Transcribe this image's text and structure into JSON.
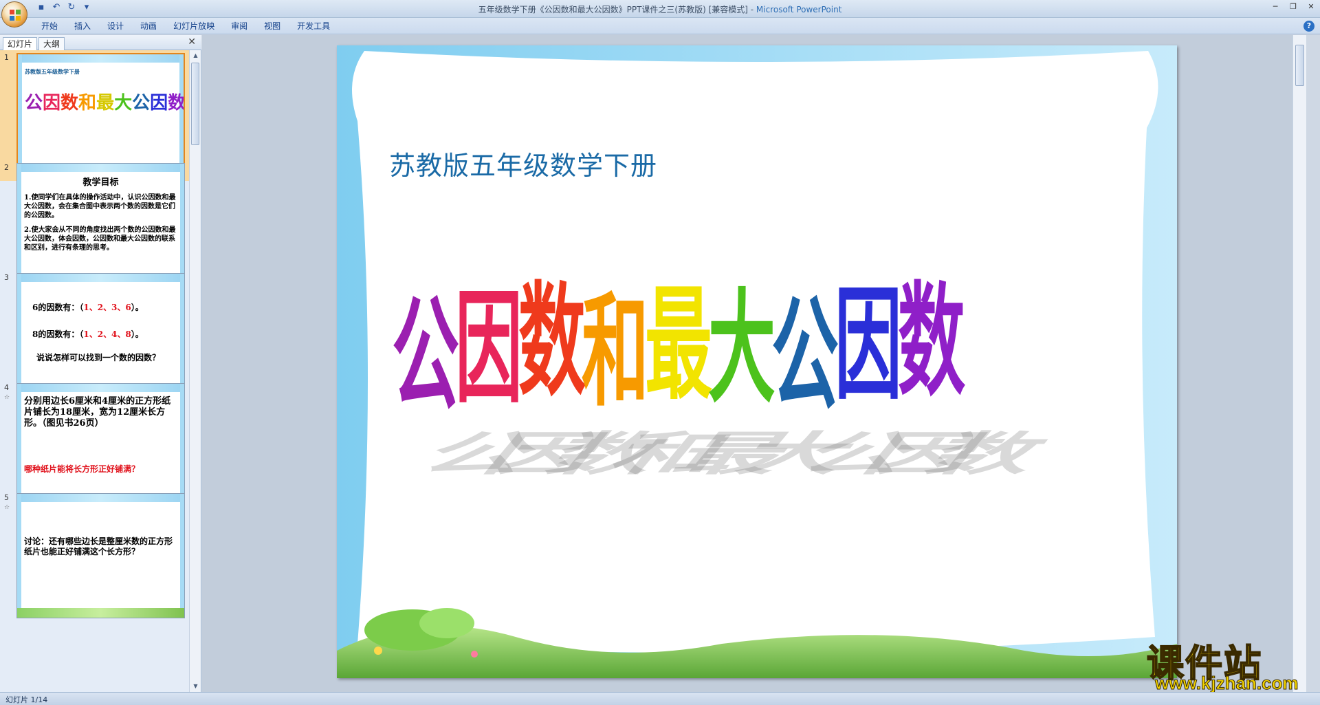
{
  "window": {
    "title": "五年级数学下册《公因数和最大公因数》PPT课件之三(苏教版) [兼容模式] - ",
    "app_name": "Microsoft PowerPoint"
  },
  "ribbon": {
    "tabs": [
      "开始",
      "插入",
      "设计",
      "动画",
      "幻灯片放映",
      "审阅",
      "视图",
      "开发工具"
    ]
  },
  "pane": {
    "tab_slides": "幻灯片",
    "tab_outline": "大纲"
  },
  "thumbnails": [
    {
      "num": "1",
      "subtitle": "苏教版五年级数学下册",
      "title_chars": [
        "公",
        "因",
        "数",
        "和",
        "最",
        "大",
        "公",
        "因",
        "数"
      ]
    },
    {
      "num": "2",
      "heading": "教学目标",
      "p1": "1.使同学们在具体的操作活动中，认识公因数和最大公因数，会在集合图中表示两个数的因数是它们的公因数。",
      "p2": "2.使大家会从不同的角度找出两个数的公因数和最大公因数，体会因数，公因数和最大公因数的联系和区别，进行有条理的思考。"
    },
    {
      "num": "3",
      "l1a": "6的因数有：（",
      "l1b": "1、2、3、6",
      "l1c": "）。",
      "l2a": "8的因数有：（",
      "l2b": "1、2、4、8",
      "l2c": "）。",
      "l3": "说说怎样可以找到一个数的因数？"
    },
    {
      "num": "4",
      "anim_mark": "☆",
      "text": "分别用边长6厘米和4厘米的正方形纸片铺长为18厘米，宽为12厘米长方形。（图见书26页）",
      "question": "哪种纸片能将长方形正好铺满？"
    },
    {
      "num": "5",
      "anim_mark": "☆",
      "text": "讨论：还有哪些边长是整厘米数的正方形纸片也能正好铺满这个长方形？"
    }
  ],
  "slide": {
    "subtitle": "苏教版五年级数学下册",
    "title_chars": [
      "公",
      "因",
      "数",
      "和",
      "最",
      "大",
      "公",
      "因",
      "数"
    ],
    "title_colors": [
      "#9b1fb0",
      "#e8255a",
      "#ef3a1c",
      "#f79a00",
      "#f2e400",
      "#4cc21c",
      "#1c63a8",
      "#2a2fd8",
      "#8f1fc8"
    ]
  },
  "watermark": {
    "name": "课件站",
    "url": "www.kjzhan.com"
  },
  "status": {
    "slide_counter": "幻灯片 1/14"
  }
}
